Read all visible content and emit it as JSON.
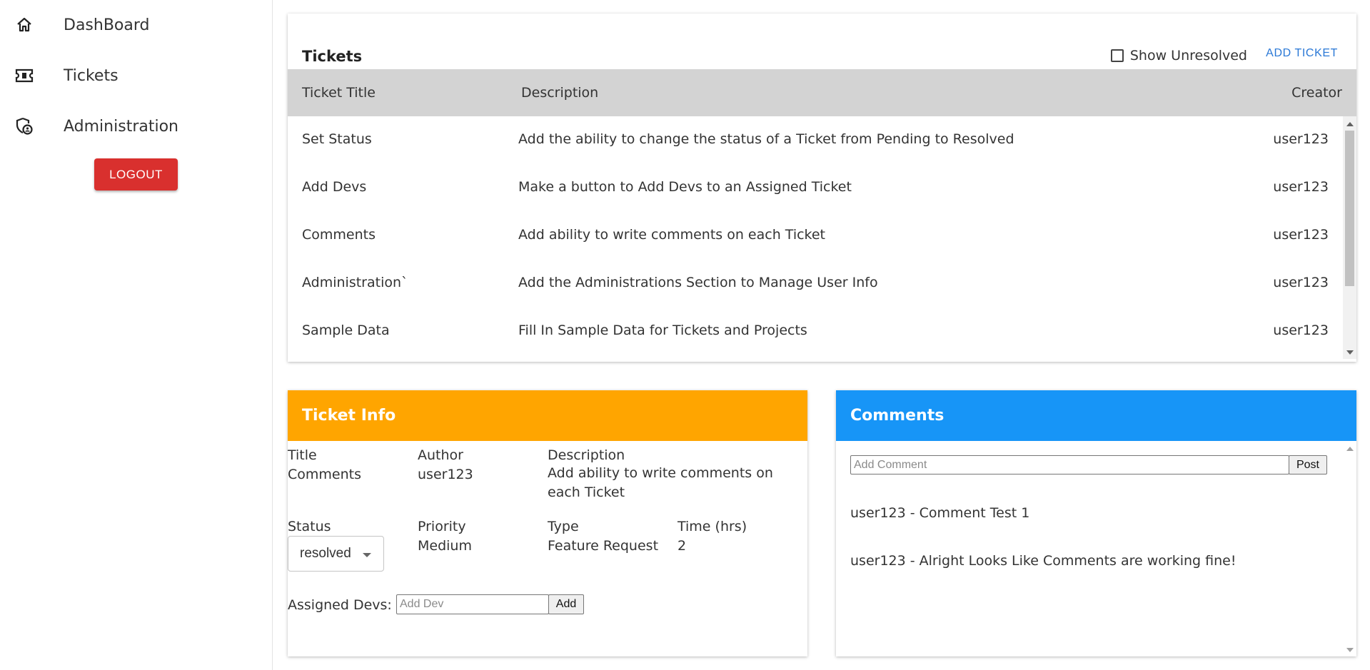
{
  "sidebar": {
    "items": [
      {
        "label": "DashBoard",
        "icon": "home-icon"
      },
      {
        "label": "Tickets",
        "icon": "ticket-icon"
      },
      {
        "label": "Administration",
        "icon": "admin-shield-icon"
      }
    ],
    "logout_label": "LOGOUT"
  },
  "tickets": {
    "title": "Tickets",
    "show_unresolved_label": "Show Unresolved",
    "show_unresolved_checked": false,
    "add_ticket_label": "ADD TICKET",
    "columns": [
      "Ticket Title",
      "Description",
      "Creator"
    ],
    "rows": [
      {
        "title": "Set Status",
        "description": "Add the ability to change the status of a Ticket from Pending to Resolved",
        "creator": "user123"
      },
      {
        "title": "Add Devs",
        "description": "Make a button to Add Devs to an Assigned Ticket",
        "creator": "user123"
      },
      {
        "title": "Comments",
        "description": "Add ability to write comments on each Ticket",
        "creator": "user123"
      },
      {
        "title": "Administration`",
        "description": "Add the Administrations Section to Manage User Info",
        "creator": "user123"
      },
      {
        "title": "Sample Data",
        "description": "Fill In Sample Data for Tickets and Projects",
        "creator": "user123"
      }
    ]
  },
  "ticket_info": {
    "header": "Ticket Info",
    "header_color": "#ffa500",
    "title_label": "Title",
    "title_value": "Comments",
    "author_label": "Author",
    "author_value": "user123",
    "description_label": "Description",
    "description_value": "Add ability to write comments on each Ticket",
    "status_label": "Status",
    "status_value": "resolved",
    "priority_label": "Priority",
    "priority_value": "Medium",
    "type_label": "Type",
    "type_value": "Feature Request",
    "time_label": "Time (hrs)",
    "time_value": "2",
    "assigned_devs_label": "Assigned Devs:",
    "add_dev_placeholder": "Add Dev",
    "add_button_label": "Add"
  },
  "comments": {
    "header": "Comments",
    "header_color": "#1795f7",
    "add_comment_placeholder": "Add Comment",
    "post_button_label": "Post",
    "items": [
      "user123 - Comment Test 1",
      "user123 - Alright Looks Like Comments are working fine!"
    ]
  },
  "colors": {
    "logout": "#d9302e",
    "link": "#2a78d6",
    "table_header": "#d3d3d3"
  }
}
